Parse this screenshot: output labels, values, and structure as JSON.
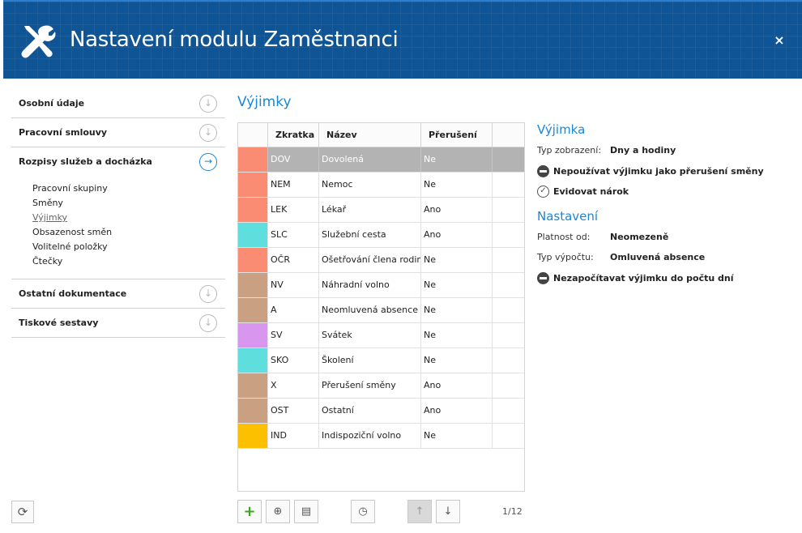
{
  "header": {
    "title": "Nastavení modulu Zaměstnanci",
    "close": "×"
  },
  "sidebar": {
    "sections": [
      {
        "label": "Osobní údaje"
      },
      {
        "label": "Pracovní smlouvy"
      },
      {
        "label": "Rozpisy služeb a docházka"
      },
      {
        "label": "Ostatní dokumentace"
      },
      {
        "label": "Tiskové sestavy"
      }
    ],
    "subitems": [
      "Pracovní skupiny",
      "Směny",
      "Výjimky",
      "Obsazenost směn",
      "Volitelné položky",
      "Čtečky"
    ]
  },
  "main": {
    "title": "Výjimky",
    "grid": {
      "headers": {
        "code": "Zkratka",
        "name": "Název",
        "break": "Přerušení"
      },
      "rows": [
        {
          "color": "#fa8c73",
          "code": "DOV",
          "name": "Dovolená",
          "break": "Ne"
        },
        {
          "color": "#fa8c73",
          "code": "NEM",
          "name": "Nemoc",
          "break": "Ne"
        },
        {
          "color": "#fa8c73",
          "code": "LEK",
          "name": "Lékař",
          "break": "Ano"
        },
        {
          "color": "#5fdede",
          "code": "SLC",
          "name": "Služební cesta",
          "break": "Ano"
        },
        {
          "color": "#fa8c73",
          "code": "OČR",
          "name": "Ošetřování člena rodiny",
          "break": "Ne"
        },
        {
          "color": "#c9a081",
          "code": "NV",
          "name": "Náhradní volno",
          "break": "Ne"
        },
        {
          "color": "#c9a081",
          "code": "A",
          "name": "Neomluvená absence",
          "break": "Ne"
        },
        {
          "color": "#d896ee",
          "code": "SV",
          "name": "Svátek",
          "break": "Ne"
        },
        {
          "color": "#5fdede",
          "code": "SKO",
          "name": "Školení",
          "break": "Ne"
        },
        {
          "color": "#c9a081",
          "code": "X",
          "name": "Přerušení směny",
          "break": "Ano"
        },
        {
          "color": "#c9a081",
          "code": "OST",
          "name": "Ostatní",
          "break": "Ano"
        },
        {
          "color": "#fcc000",
          "code": "IND",
          "name": "Indispoziční volno",
          "break": "Ne"
        }
      ]
    },
    "pager": "1/12"
  },
  "detail": {
    "exception_title": "Výjimka",
    "display_type_label": "Typ zobrazení:",
    "display_type_value": "Dny a hodiny",
    "flag_no_break": "Nepoužívat výjimku jako přerušení směny",
    "flag_claim": "Evidovat nárok",
    "settings_title": "Nastavení",
    "valid_from_label": "Platnost od:",
    "valid_from_value": "Neomezeně",
    "calc_type_label": "Typ výpočtu:",
    "calc_type_value": "Omluvená absence",
    "flag_no_days": "Nezapočítavat výjimku do počtu dní"
  },
  "icons": {
    "header": "wrench-screwdriver-icon",
    "nav_arrow": "circle-arrow-down-icon",
    "nav_active": "circle-arrow-right-icon"
  },
  "colors": {
    "header": "#0f5596",
    "accent": "#1a86d6",
    "selected_row": "#b3b3b3"
  }
}
